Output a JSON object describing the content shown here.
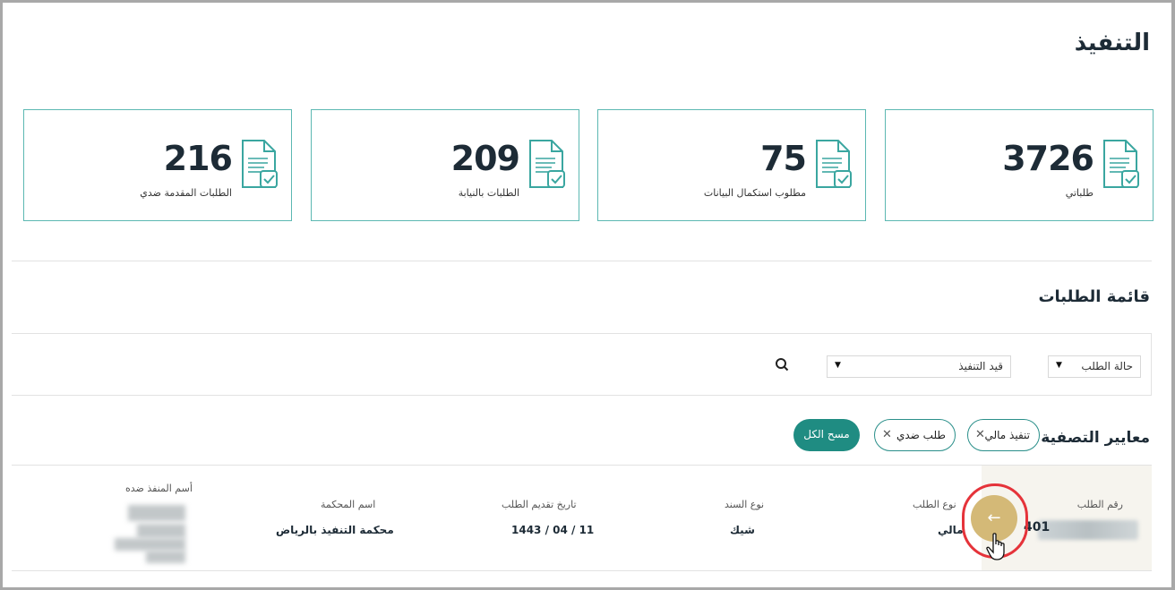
{
  "page": {
    "title": "التنفيذ"
  },
  "stats": [
    {
      "value": "3726",
      "label": "طلباتي",
      "icon": "document-check-icon"
    },
    {
      "value": "75",
      "label": "مطلوب استكمال البيانات",
      "icon": "document-check-icon"
    },
    {
      "value": "209",
      "label": "الطلبات بالنيابة",
      "icon": "document-check-icon"
    },
    {
      "value": "216",
      "label": "الطلبات المقدمة ضدي",
      "icon": "document-check-icon"
    }
  ],
  "requests": {
    "title": "قائمة الطلبات",
    "status_select": "حالة الطلب",
    "execution_select": "قيد التنفيذ",
    "search_icon": "search-icon"
  },
  "filters": {
    "title": "معايير التصفية",
    "chips": [
      "تنفيذ مالي",
      "طلب ضدي"
    ],
    "clear_label": "مسح الكل"
  },
  "table": {
    "headers": {
      "request_number": "رقم الطلب",
      "request_type": "نوع الطلب",
      "bond_type": "نوع السند",
      "submit_date": "تاريخ تقديم الطلب",
      "court_name": "اسم المحكمة",
      "executed_against": "أسم المنفذ ضده"
    },
    "row": {
      "request_number": "401",
      "request_type": "مالي",
      "bond_type": "شيك",
      "submit_date": "1443 / 04 / 11",
      "court_name": "محكمة التنفيذ بالرياض"
    },
    "arrow_icon": "arrow-left-icon"
  },
  "colors": {
    "accent": "#1f8c82",
    "card_border": "#5cb8b2",
    "highlight": "#e5333a",
    "arrow_btn": "#d4b977"
  }
}
